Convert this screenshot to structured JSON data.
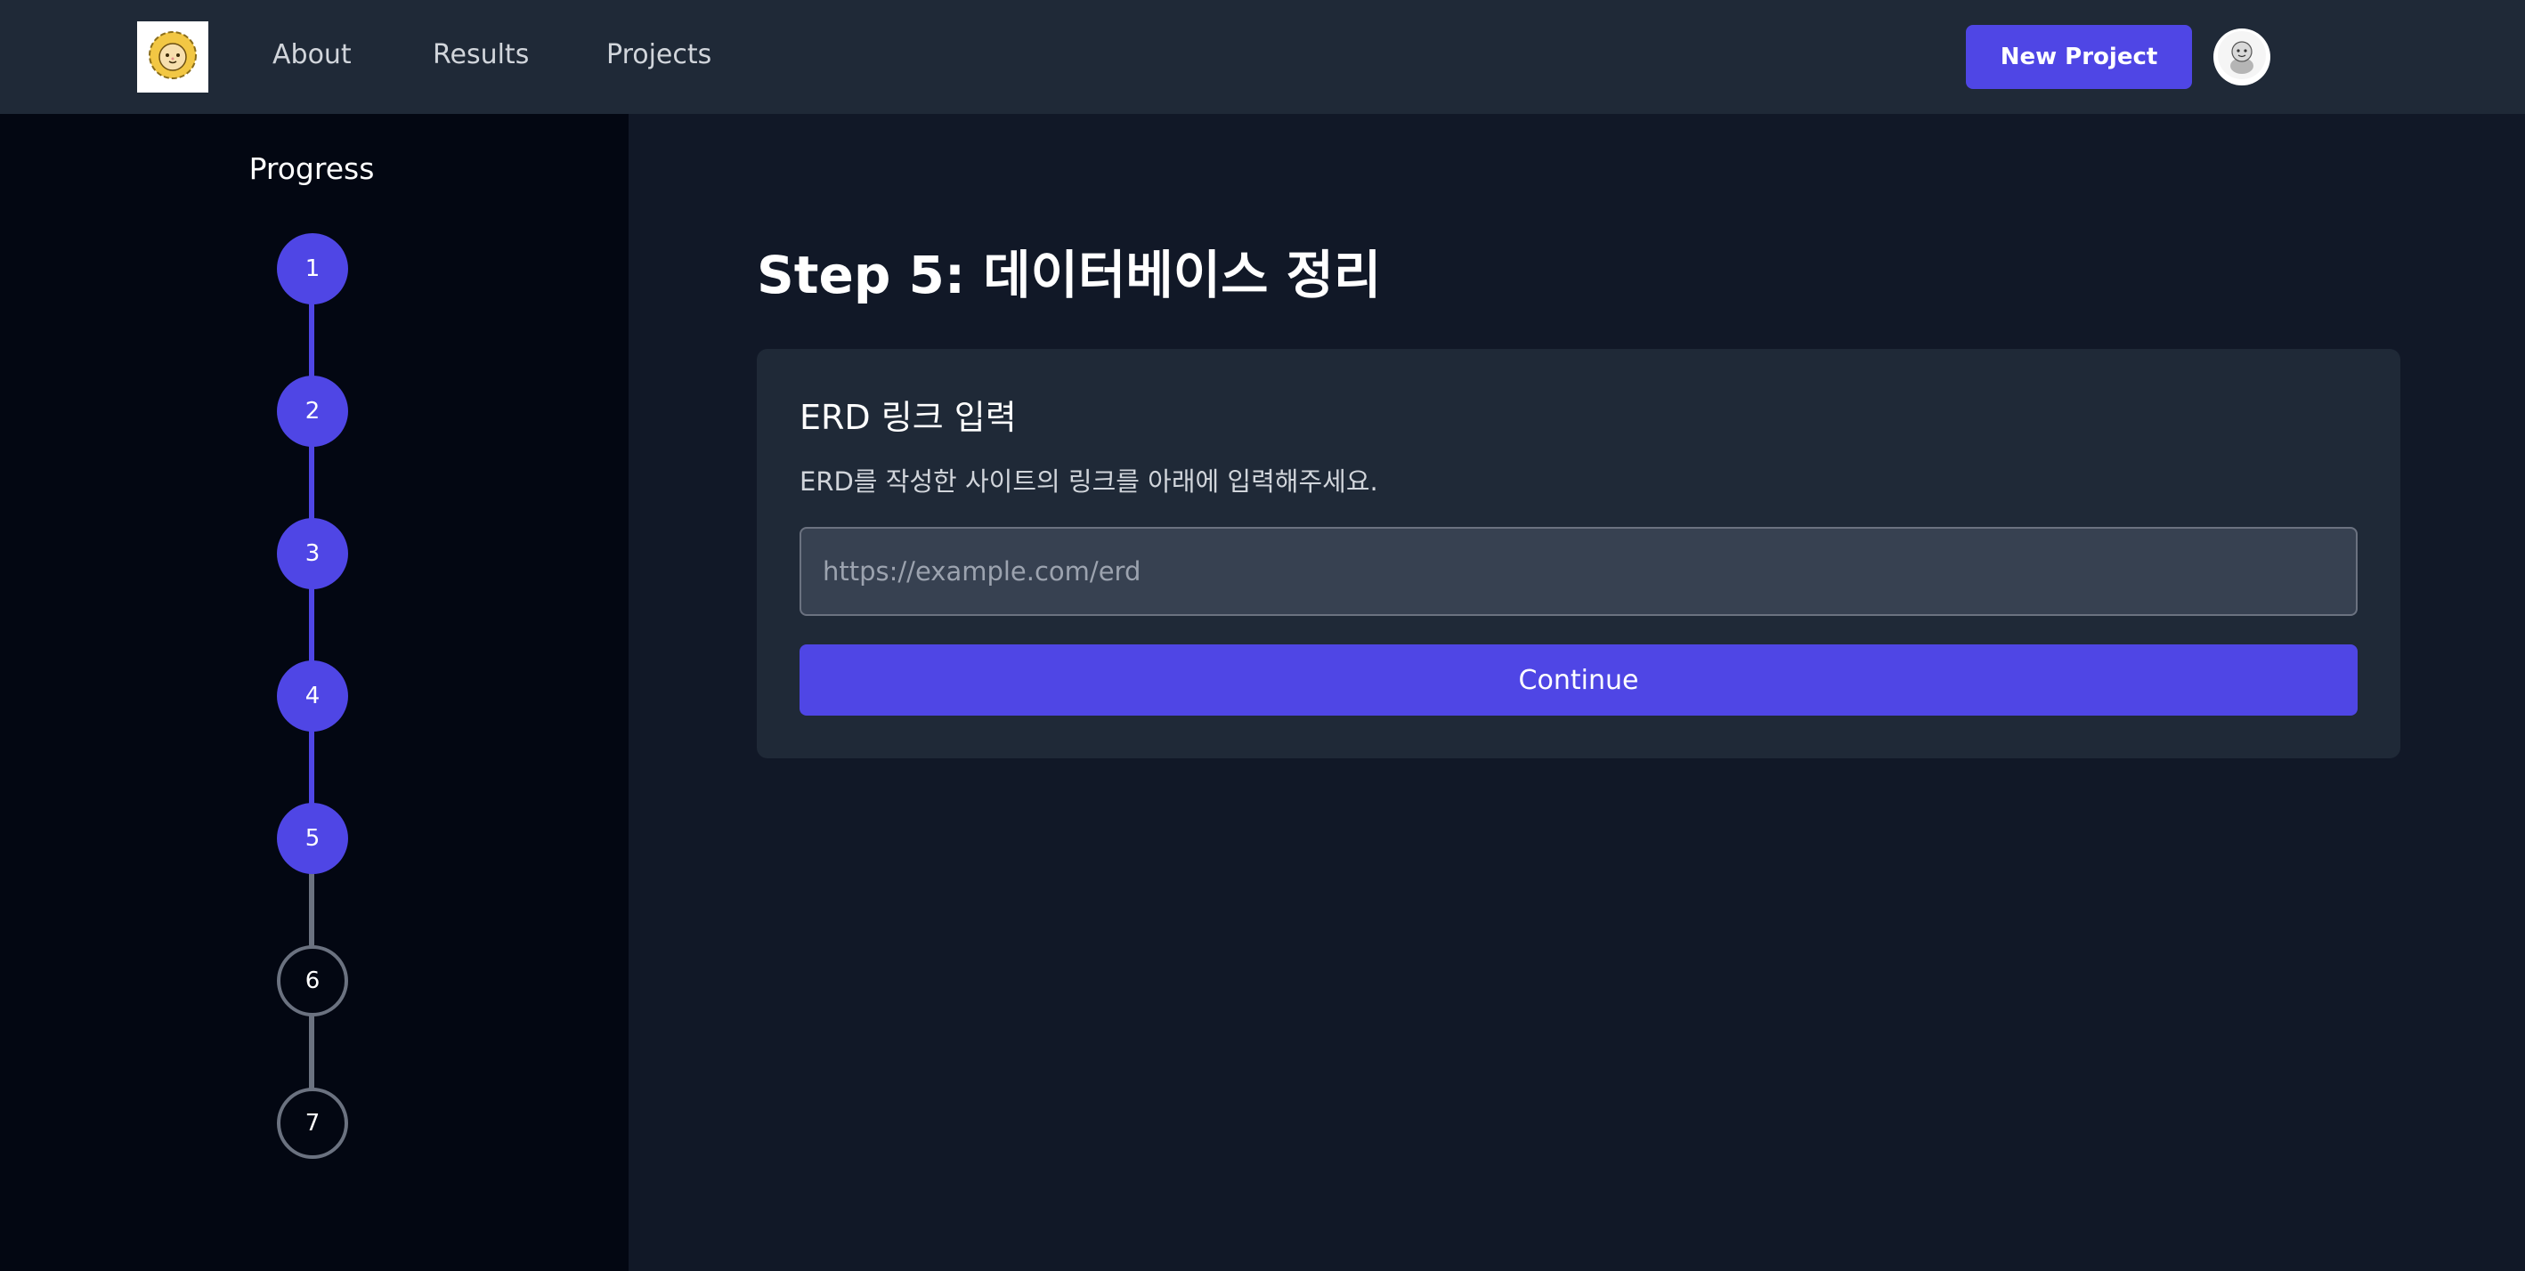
{
  "nav": {
    "logo_icon": "lion-face-icon",
    "links": [
      "About",
      "Results",
      "Projects"
    ],
    "new_project_label": "New Project",
    "avatar_icon": "user-avatar-icon"
  },
  "sidebar": {
    "title": "Progress",
    "steps": [
      "1",
      "2",
      "3",
      "4",
      "5",
      "6",
      "7"
    ],
    "current_step": 5
  },
  "main": {
    "title": "Step 5: 데이터베이스 정리",
    "card": {
      "title": "ERD 링크 입력",
      "description": "ERD를 작성한 사이트의 링크를 아래에 입력해주세요.",
      "input_value": "",
      "input_placeholder": "https://example.com/erd",
      "continue_label": "Continue"
    }
  },
  "colors": {
    "accent": "#4f46e5",
    "nav_bg": "#1f2937",
    "sidebar_bg": "#030712",
    "main_bg": "#111827",
    "inactive_step": "#6b7280"
  }
}
